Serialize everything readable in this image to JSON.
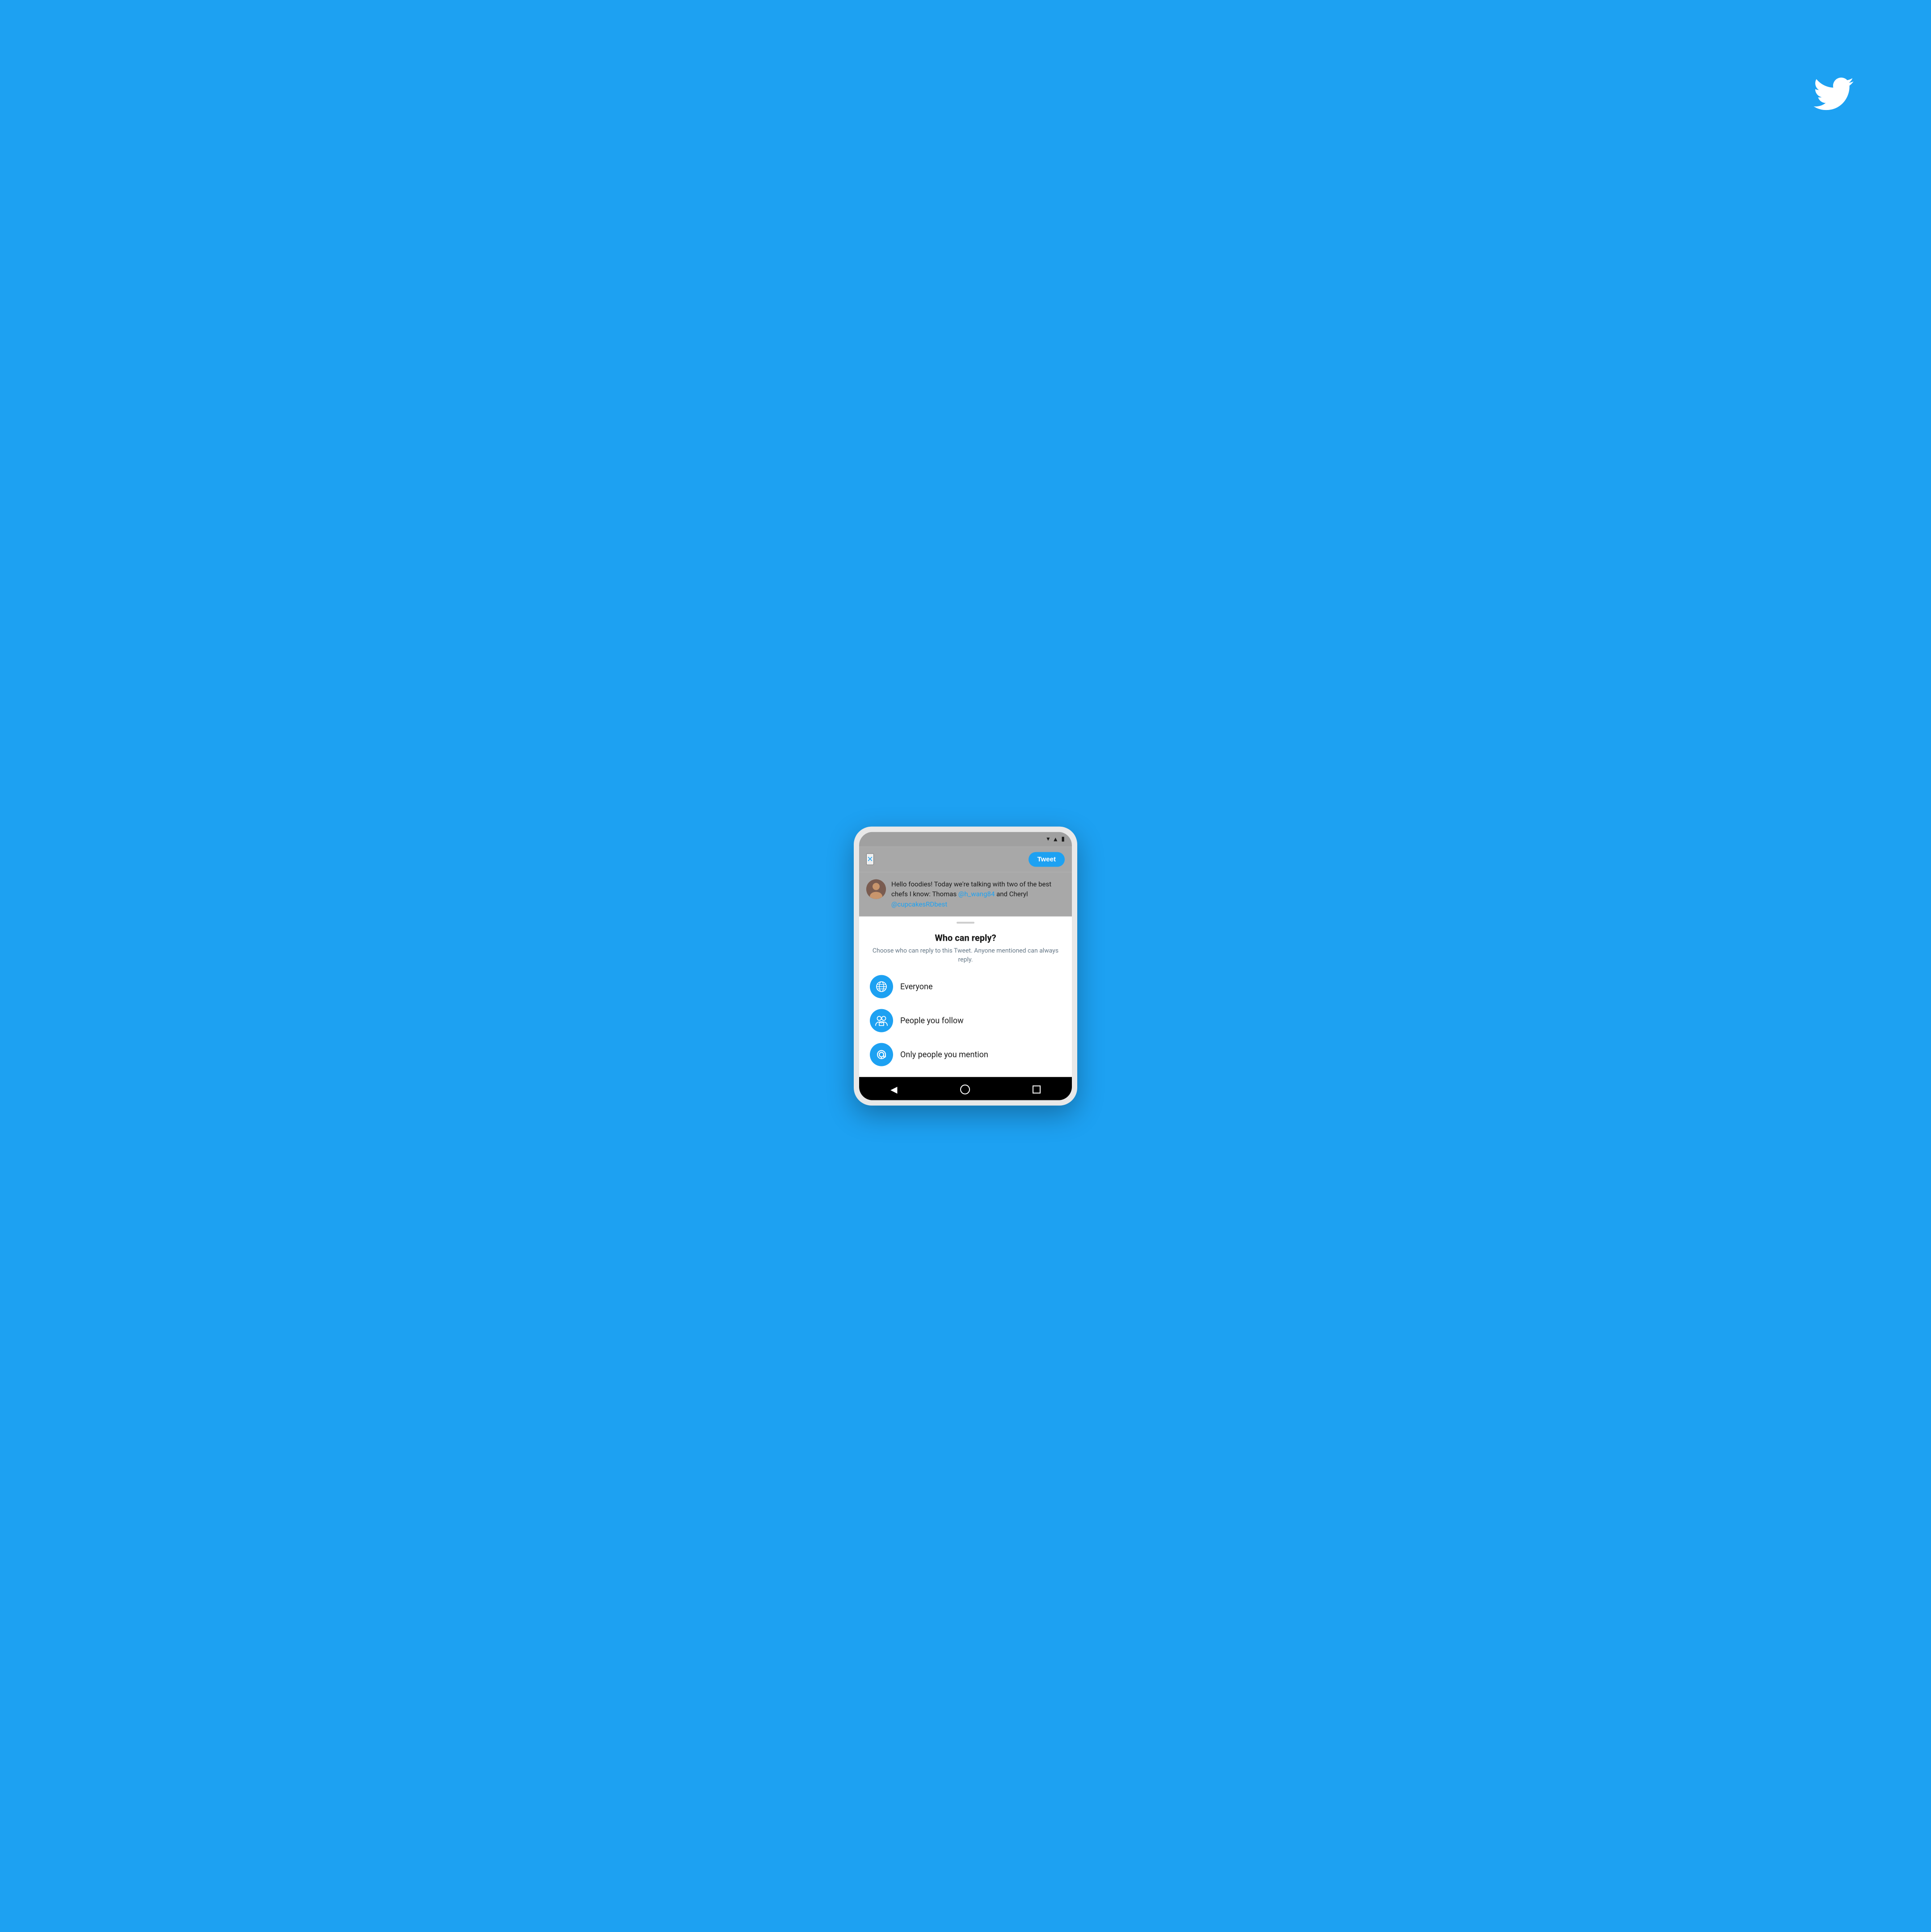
{
  "background": {
    "color": "#1DA1F2"
  },
  "twitter_logo": {
    "label": "Twitter logo"
  },
  "phone": {
    "status_bar": {
      "wifi_icon": "wifi",
      "signal_icon": "signal",
      "battery_icon": "battery"
    },
    "top_bar": {
      "close_label": "×",
      "tweet_button_label": "Tweet"
    },
    "tweet": {
      "text_part1": "Hello foodies! Today we're talking with two of the best chefs I know: Thomas ",
      "mention1": "@h_wang84",
      "text_part2": " and Cheryl ",
      "mention2": "@cupcakesRDbest"
    },
    "bottom_sheet": {
      "title": "Who can reply?",
      "subtitle": "Choose who can reply to this Tweet. Anyone mentioned can always reply.",
      "options": [
        {
          "id": "everyone",
          "label": "Everyone",
          "icon": "globe"
        },
        {
          "id": "people-you-follow",
          "label": "People you follow",
          "icon": "group"
        },
        {
          "id": "only-mention",
          "label": "Only people you mention",
          "icon": "at"
        }
      ]
    },
    "nav_bar": {
      "back_label": "◀",
      "home_label": "○",
      "recents_label": "□"
    }
  }
}
